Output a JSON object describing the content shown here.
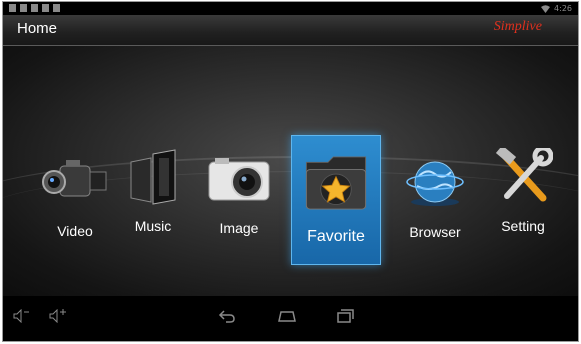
{
  "status_bar": {
    "time": "4:26"
  },
  "header": {
    "title": "Home",
    "brand": "Simplive"
  },
  "menu": {
    "items": [
      {
        "label": "Video",
        "icon": "video-camera-icon"
      },
      {
        "label": "Music",
        "icon": "speakers-icon"
      },
      {
        "label": "Image",
        "icon": "camera-icon"
      },
      {
        "label": "Favorite",
        "icon": "star-folder-icon",
        "selected": true
      },
      {
        "label": "Browser",
        "icon": "globe-icon"
      },
      {
        "label": "Setting",
        "icon": "tools-icon"
      }
    ]
  },
  "navbar": {
    "icons": [
      "volume-down-icon",
      "volume-up-icon",
      "back-icon",
      "home-icon",
      "recent-apps-icon"
    ]
  },
  "colors": {
    "selected_tile": "#1e78bd",
    "brand": "#e0301e"
  }
}
